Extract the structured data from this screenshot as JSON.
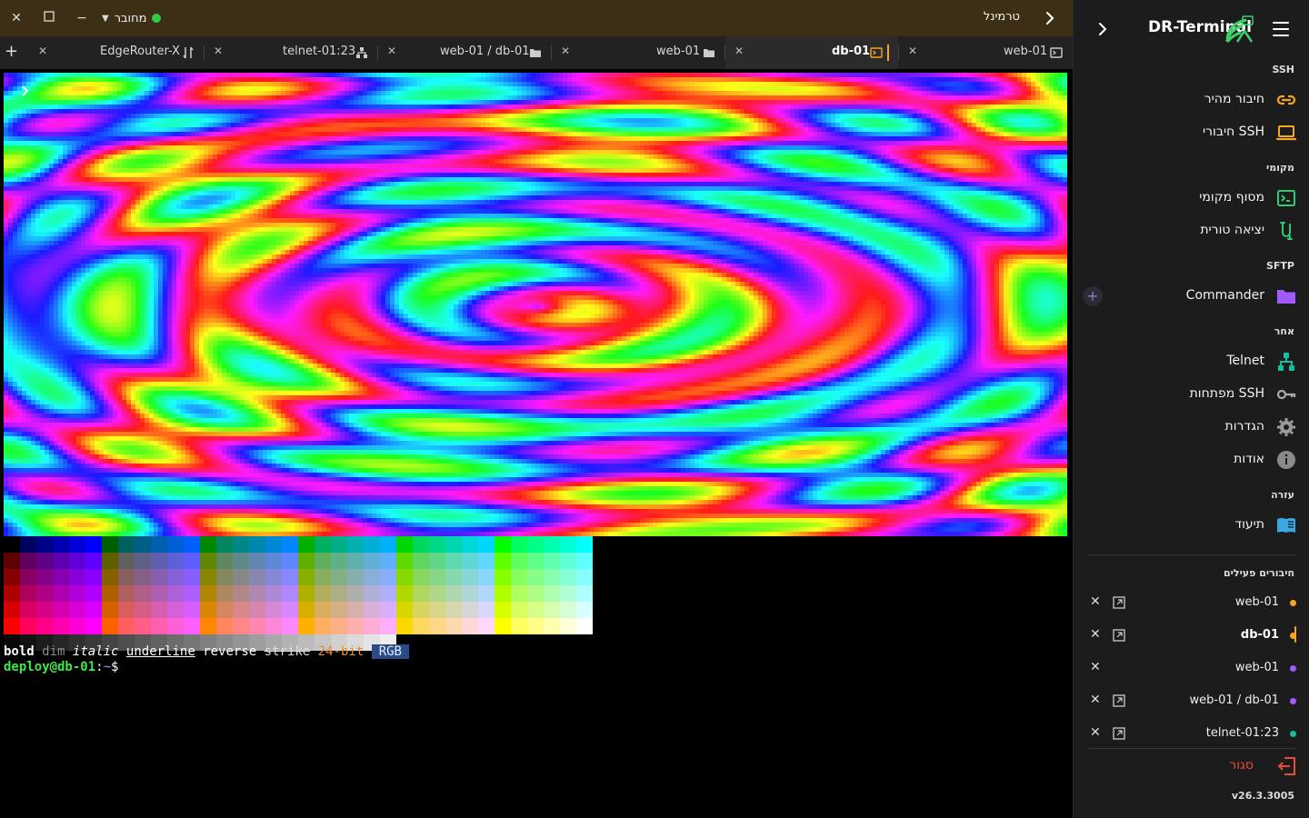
{
  "titlebar": {
    "status": "מחובר",
    "status_color": "#2ecc40",
    "title": "טרמינל"
  },
  "tabs": [
    {
      "label": "web-01",
      "icon": "terminal-window-icon",
      "active": false
    },
    {
      "label": "db-01",
      "icon": "terminal-orange-icon",
      "active": true
    },
    {
      "label": "web-01",
      "icon": "folder-icon",
      "active": false
    },
    {
      "label": "web-01 / db-01",
      "icon": "folder-icon",
      "active": false
    },
    {
      "label": "telnet-01:23",
      "icon": "network-icon",
      "active": false
    },
    {
      "label": "EdgeRouter-X",
      "icon": "serial-icon",
      "active": false
    }
  ],
  "terminal": {
    "styles": {
      "bold": "bold",
      "dim": "dim",
      "italic": "italic",
      "underline": "underline",
      "reverse": "reverse",
      "strike": "strike",
      "bit24": "24-bit",
      "rgb": "RGB"
    },
    "prompt": {
      "user": "deploy@db-01",
      "sep": ":",
      "dir": "~",
      "sym": "$"
    }
  },
  "sidebar": {
    "app_title": "DR-Terminal",
    "sections": {
      "ssh": "SSH",
      "local": "מקומי",
      "sftp": "SFTP",
      "other": "אחר",
      "help": "עזרה",
      "active": "חיבורים פעילים"
    },
    "items": {
      "quick_connect": "חיבור מהיר",
      "ssh_connections": "חיבורי SSH",
      "local_terminal": "מסוף מקומי",
      "serial": "יציאה טורית",
      "commander": "Commander",
      "telnet": "Telnet",
      "ssh_keys": "מפתחות SSH",
      "settings": "הגדרות",
      "about": "אודות",
      "docs": "תיעוד"
    },
    "active_connections": [
      {
        "name": "web-01",
        "color": "#f5a623",
        "active": false,
        "ext": true
      },
      {
        "name": "db-01",
        "color": "#f5a623",
        "active": true,
        "ext": true
      },
      {
        "name": "web-01",
        "color": "#a259ff",
        "active": false,
        "ext": false
      },
      {
        "name": "web-01 / db-01",
        "color": "#a259ff",
        "active": false,
        "ext": true
      },
      {
        "name": "telnet-01:23",
        "color": "#1abc9c",
        "active": false,
        "ext": true
      }
    ],
    "logout": "סגור",
    "version": "v26.3.3005"
  }
}
